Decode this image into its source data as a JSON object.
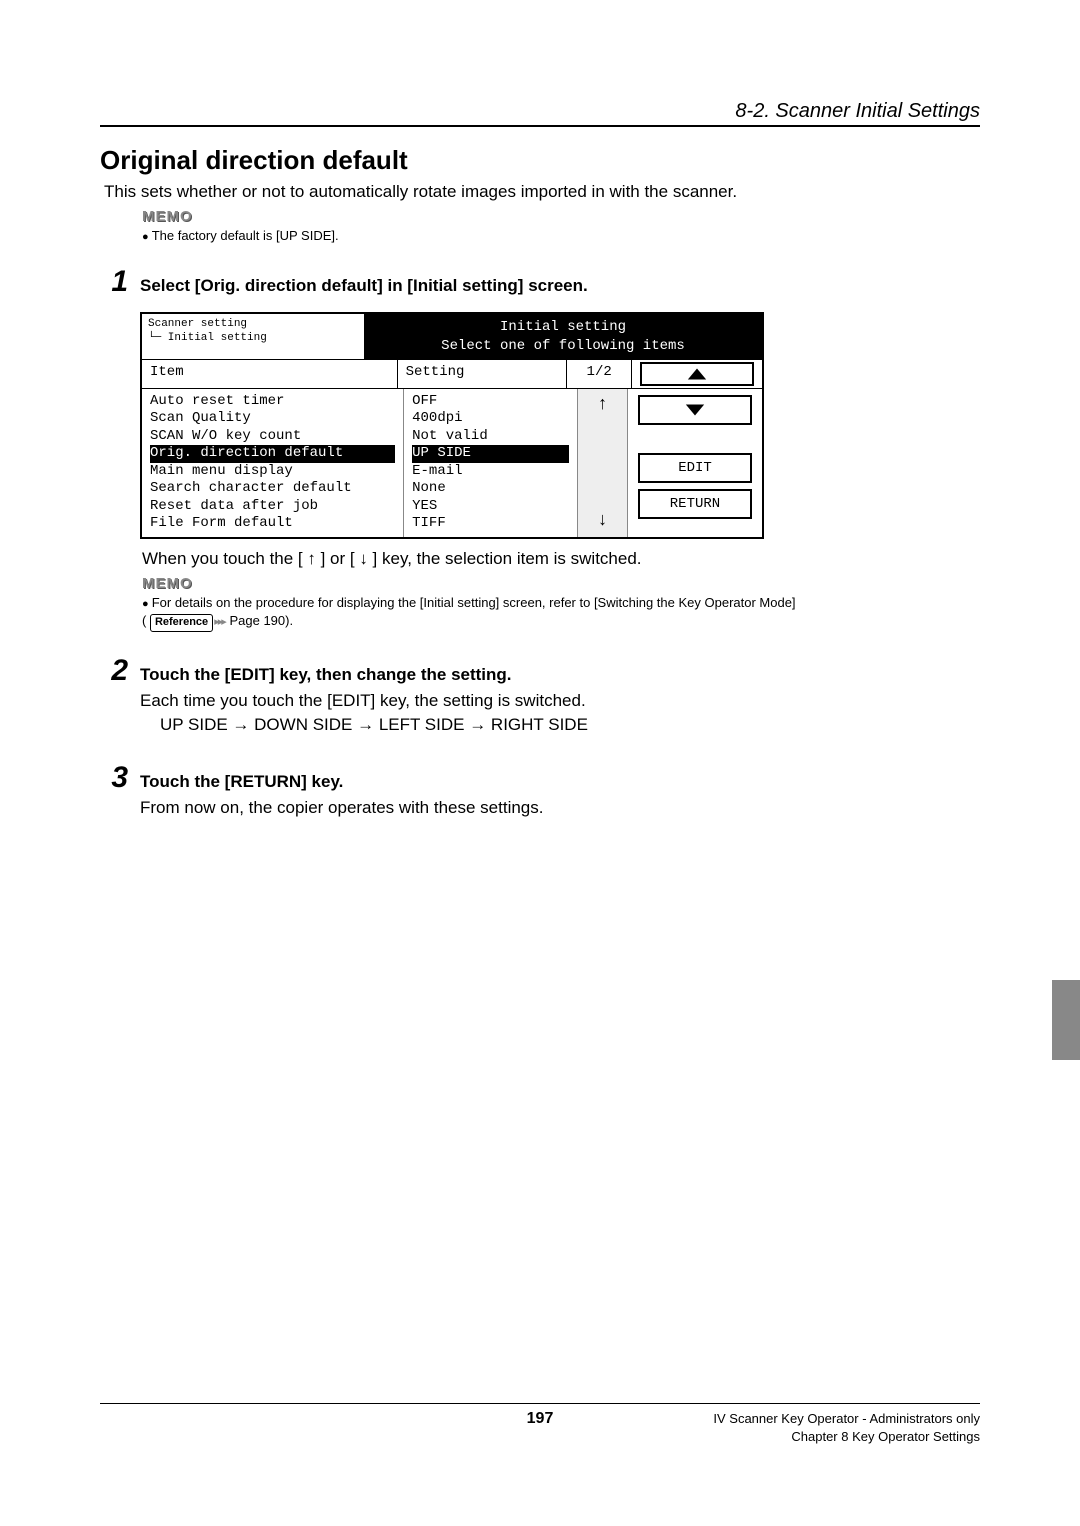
{
  "header": {
    "section_label": "8-2. Scanner Initial Settings"
  },
  "title": "Original direction default",
  "intro": "This sets whether or not to automatically rotate images imported in with the scanner.",
  "memo1": {
    "label": "MEMO",
    "line1": "The factory default is [UP SIDE]."
  },
  "step1": {
    "num": "1",
    "head": "Select [Orig. direction default] in [Initial setting] screen.",
    "after": "When you touch the [ ↑ ] or [ ↓ ] key, the selection item is switched."
  },
  "ui": {
    "breadcrumb1": "Scanner setting",
    "breadcrumb2": "└─ Initial setting",
    "title1": "Initial setting",
    "title2": "Select one of following items",
    "hdr_item": "Item",
    "hdr_setting": "Setting",
    "page": "1/2",
    "rows": [
      {
        "item": "Auto reset timer",
        "setting": "OFF",
        "hl": false
      },
      {
        "item": "Scan Quality",
        "setting": "400dpi",
        "hl": false
      },
      {
        "item": "SCAN W/O key count",
        "setting": "Not valid",
        "hl": false
      },
      {
        "item": "Orig. direction default",
        "setting": "UP SIDE",
        "hl": true
      },
      {
        "item": "Main menu display",
        "setting": "E-mail",
        "hl": false
      },
      {
        "item": "Search character default",
        "setting": "None",
        "hl": false
      },
      {
        "item": "Reset data after job",
        "setting": "YES",
        "hl": false
      },
      {
        "item": "File Form default",
        "setting": "TIFF",
        "hl": false
      }
    ],
    "btn_edit": "EDIT",
    "btn_return": "RETURN",
    "up_arrow": "↑",
    "down_arrow": "↓"
  },
  "memo2": {
    "label": "MEMO",
    "line1": "For details on the procedure for displaying the [Initial setting] screen, refer to [Switching the Key Operator Mode]",
    "ref_label": "Reference",
    "page_ref": "Page 190)."
  },
  "step2": {
    "num": "2",
    "head": "Touch the [EDIT] key, then change the setting.",
    "line1": "Each time you touch the [EDIT] key, the setting is switched.",
    "line2": "UP SIDE → DOWN SIDE → LEFT SIDE → RIGHT SIDE"
  },
  "step3": {
    "num": "3",
    "head": "Touch the [RETURN] key.",
    "line1": "From now on, the copier operates with these settings."
  },
  "footer": {
    "page_num": "197",
    "right1": "IV Scanner Key Operator - Administrators only",
    "right2": "Chapter 8 Key Operator Settings"
  }
}
